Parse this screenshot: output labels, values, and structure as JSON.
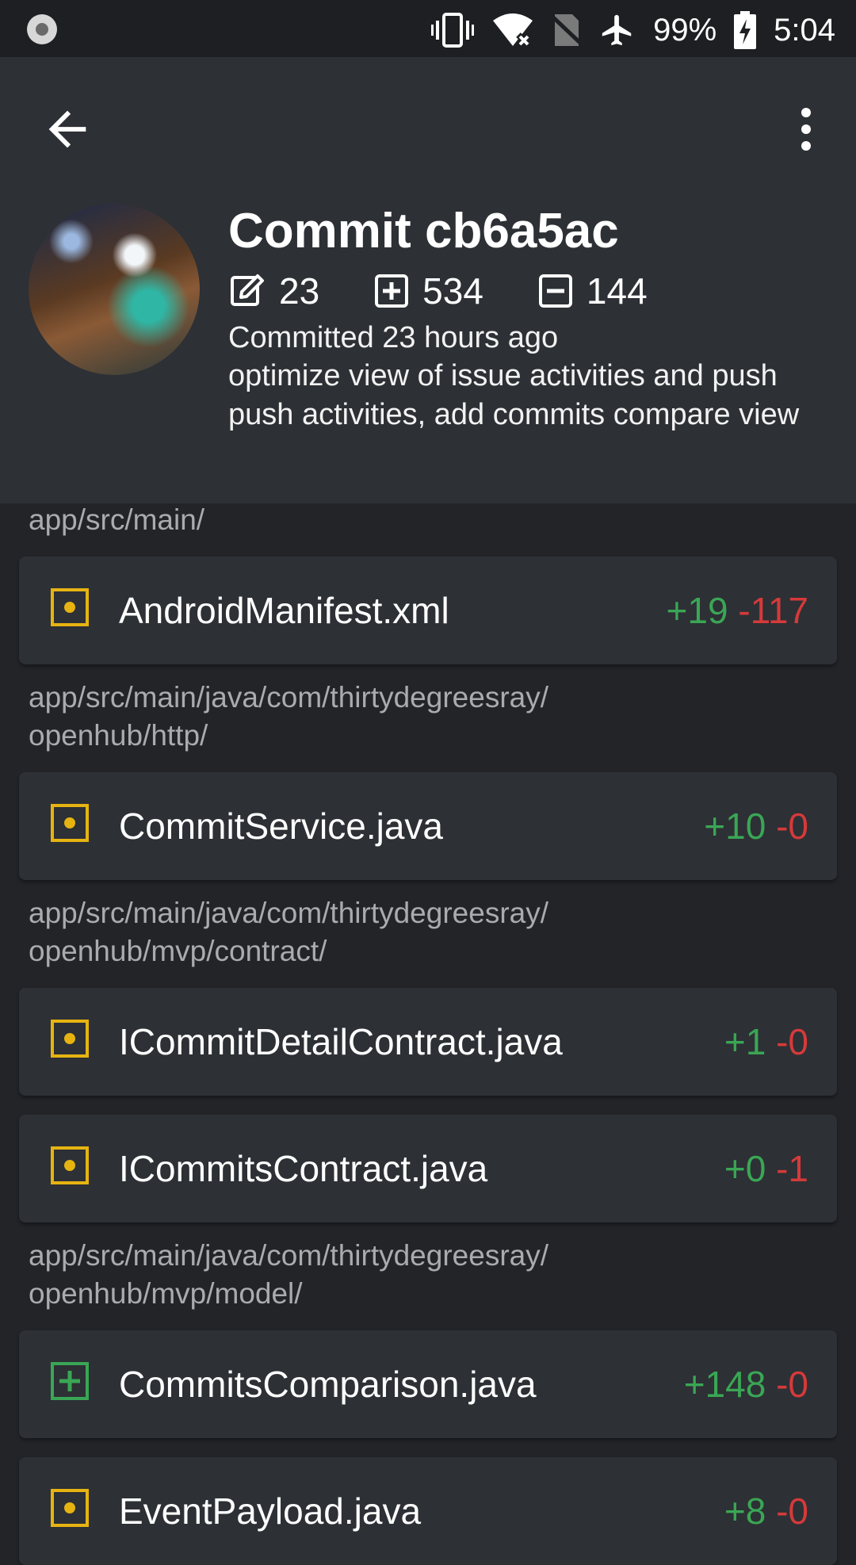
{
  "status_bar": {
    "battery": "99%",
    "time": "5:04",
    "icons": [
      "record-icon",
      "vibrate-icon",
      "wifi-off-icon",
      "no-sim-icon",
      "airplane-icon",
      "battery-charging-icon"
    ]
  },
  "toolbar": {
    "back_icon": "arrow-left-icon",
    "more_icon": "more-vert-icon"
  },
  "commit": {
    "title": "Commit cb6a5ac",
    "changed": "23",
    "additions": "534",
    "deletions": "144",
    "committed": "Committed 23 hours ago",
    "message": "optimize view of issue activities and push push activities, add commits compare view"
  },
  "colors": {
    "modified": "#e6b311",
    "added": "#3aa655",
    "deleted": "#d53a3a",
    "card": "#2d3035",
    "background": "#222428"
  },
  "groups": [
    {
      "path": "app/src/main/",
      "files": [
        {
          "name": "AndroidManifest.xml",
          "status": "modified",
          "add": "+19",
          "del": "-117"
        }
      ]
    },
    {
      "path": "app/src/main/java/com/thirtydegreesray/\nopenhub/http/",
      "files": [
        {
          "name": "CommitService.java",
          "status": "modified",
          "add": "+10",
          "del": "-0"
        }
      ]
    },
    {
      "path": "app/src/main/java/com/thirtydegreesray/\nopenhub/mvp/contract/",
      "files": [
        {
          "name": "ICommitDetailContract.java",
          "status": "modified",
          "add": "+1",
          "del": "-0"
        },
        {
          "name": "ICommitsContract.java",
          "status": "modified",
          "add": "+0",
          "del": "-1"
        }
      ]
    },
    {
      "path": "app/src/main/java/com/thirtydegreesray/\nopenhub/mvp/model/",
      "files": [
        {
          "name": "CommitsComparison.java",
          "status": "added",
          "add": "+148",
          "del": "-0"
        },
        {
          "name": "EventPayload.java",
          "status": "modified",
          "add": "+8",
          "del": "-0"
        }
      ]
    }
  ]
}
